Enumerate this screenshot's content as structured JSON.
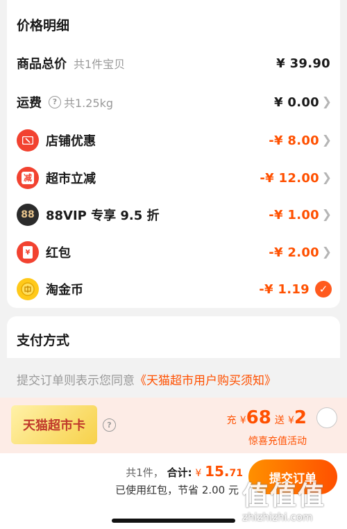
{
  "price_section": {
    "title": "价格明细",
    "items": [
      {
        "label": "商品总价",
        "sub": "共1件宝贝",
        "amount": "¥ 39.90",
        "red": false,
        "chevron": false
      },
      {
        "label": "运费",
        "help": "?",
        "sub": "共1.25kg",
        "amount": "¥ 0.00",
        "red": false,
        "chevron": true
      },
      {
        "label": "店铺优惠",
        "icon": "coupon-icon",
        "amount": "-¥ 8.00",
        "red": true,
        "chevron": true
      },
      {
        "label": "超市立减",
        "icon": "discount-icon",
        "icon_text": "减",
        "amount": "-¥ 12.00",
        "red": true,
        "chevron": true
      },
      {
        "label": "88VIP 专享 9.5 折",
        "icon": "vip88-icon",
        "icon_text": "88",
        "amount": "-¥ 1.00",
        "red": true,
        "chevron": true
      },
      {
        "label": "红包",
        "icon": "red-packet-icon",
        "icon_text": "¥",
        "amount": "-¥ 2.00",
        "red": true,
        "chevron": true
      },
      {
        "label": "淘金币",
        "icon": "gold-coin-icon",
        "amount": "-¥ 1.19",
        "red": true,
        "checked": true
      }
    ]
  },
  "payment_section": {
    "title": "支付方式"
  },
  "agreement": {
    "text": "提交订单则表示您同意",
    "link": "《天猫超市用户购买须知》"
  },
  "promo": {
    "card_name": "天猫超市卡",
    "help": "?",
    "charge_label": "充",
    "currency": "¥",
    "charge_amount": "68",
    "bonus_label": "送",
    "bonus_amount": "2",
    "activity": "惊喜充值活动"
  },
  "footer": {
    "count": "共1件，",
    "total_label": "合计:",
    "currency": "¥",
    "total_int": "15.",
    "total_dec": "71",
    "saved": "已使用红包，节省 2.00 元",
    "submit_label": "提交订单"
  },
  "watermark": {
    "glyphs": "值值值",
    "url": "zhizhizhi.com"
  },
  "colors": {
    "accent": "#ff5000",
    "background": "#f2f2f2",
    "check": "#ff5a1e"
  }
}
